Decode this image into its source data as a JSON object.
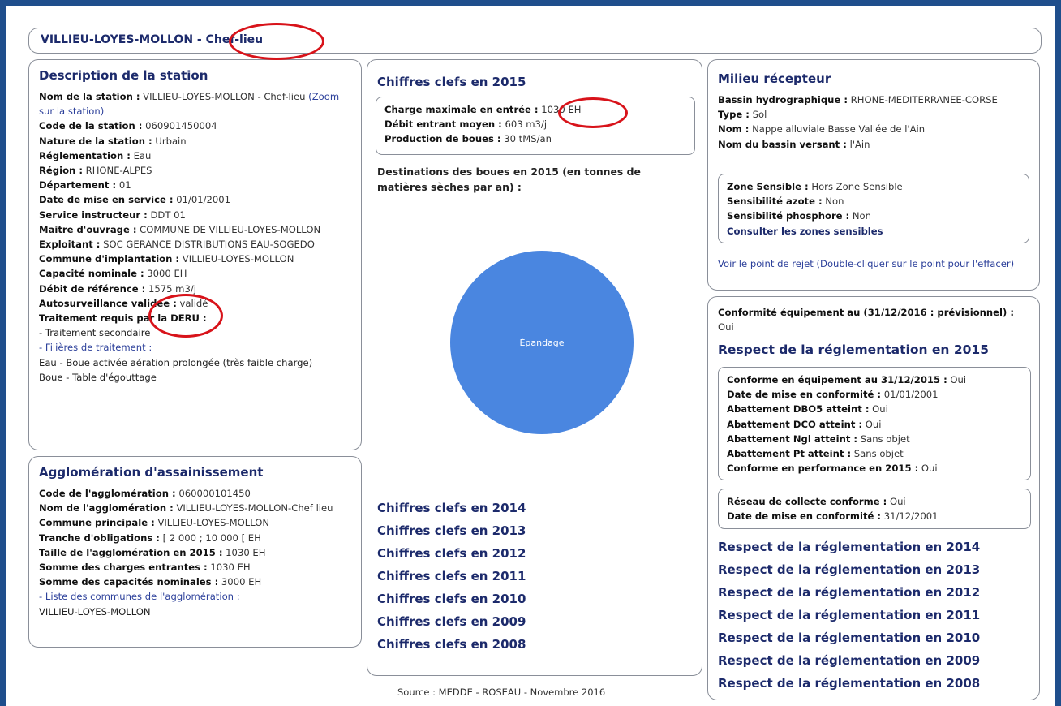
{
  "title": {
    "station": "VILLIEU-LOYES-MOLLON",
    "sep": " - ",
    "suffix": "Chef-lieu"
  },
  "description": {
    "heading": "Description de la station",
    "rows": [
      {
        "label": "Nom de la station :",
        "value": " VILLIEU-LOYES-MOLLON - Chef-lieu",
        "link": " (Zoom sur la station)"
      },
      {
        "label": "Code de la station :",
        "value": " 060901450004"
      },
      {
        "label": "Nature de la station :",
        "value": " Urbain"
      },
      {
        "label": "Réglementation :",
        "value": " Eau"
      },
      {
        "label": "Région :",
        "value": " RHONE-ALPES"
      },
      {
        "label": "Département :",
        "value": " 01"
      },
      {
        "label": "Date de mise en service :",
        "value": " 01/01/2001"
      },
      {
        "label": "Service instructeur :",
        "value": " DDT 01"
      },
      {
        "label": "Maitre d'ouvrage :",
        "value": " COMMUNE DE VILLIEU-LOYES-MOLLON"
      },
      {
        "label": "Exploitant :",
        "value": " SOC GERANCE DISTRIBUTIONS EAU-SOGEDO"
      },
      {
        "label": "Commune d'implantation :",
        "value": " VILLIEU-LOYES-MOLLON"
      },
      {
        "label": "Capacité nominale :",
        "value": " 3000 EH"
      },
      {
        "label": "Débit de référence :",
        "value": " 1575 m3/j"
      },
      {
        "label": "Autosurveillance validée :",
        "value": " validé"
      },
      {
        "label": "Traitement requis par la DERU :",
        "value": ""
      }
    ],
    "deru_value": "- Traitement secondaire",
    "filieres_link": "- Filières de traitement :",
    "filiere_eau": "Eau - Boue activée aération prolongée (très faible charge)",
    "filiere_boue": "Boue - Table d'égouttage"
  },
  "agglomeration": {
    "heading": "Agglomération d'assainissement",
    "rows": [
      {
        "label": "Code de l'agglomération :",
        "value": " 060000101450"
      },
      {
        "label": "Nom de l'agglomération :",
        "value": " VILLIEU-LOYES-MOLLON-Chef lieu"
      },
      {
        "label": "Commune principale :",
        "value": " VILLIEU-LOYES-MOLLON"
      },
      {
        "label": "Tranche d'obligations :",
        "value": " [ 2 000 ; 10 000 [ EH"
      },
      {
        "label": "Taille de l'agglomération en 2015 :",
        "value": " 1030 EH"
      },
      {
        "label": "Somme des charges entrantes :",
        "value": " 1030 EH"
      },
      {
        "label": "Somme des capacités nominales :",
        "value": " 3000 EH"
      }
    ],
    "communes_link": "- Liste des communes de l'agglomération :",
    "communes_value": "VILLIEU-LOYES-MOLLON"
  },
  "chiffres": {
    "heading": "Chiffres clefs en 2015",
    "rows": [
      {
        "label": "Charge maximale en entrée :",
        "value": " 1030 EH"
      },
      {
        "label": "Débit entrant moyen :",
        "value": " 603 m3/j"
      },
      {
        "label": "Production de boues :",
        "value": " 30 tMS/an"
      }
    ],
    "destinations_title": "Destinations des boues en 2015 (en tonnes de matières sèches par an) :",
    "years": [
      "Chiffres clefs en 2014",
      "Chiffres clefs en 2013",
      "Chiffres clefs en 2012",
      "Chiffres clefs en 2011",
      "Chiffres clefs en 2010",
      "Chiffres clefs en 2009",
      "Chiffres clefs en 2008"
    ]
  },
  "chart_data": {
    "type": "pie",
    "title": "Destinations des boues en 2015 (en tonnes de matières sèches par an) :",
    "categories": [
      "Épandage"
    ],
    "values": [
      100
    ],
    "colors": [
      "#4a86e0"
    ]
  },
  "milieu": {
    "heading": "Milieu récepteur",
    "rows": [
      {
        "label": "Bassin hydrographique :",
        "value": " RHONE-MEDITERRANEE-CORSE"
      },
      {
        "label": "Type :",
        "value": " Sol"
      },
      {
        "label": "Nom :",
        "value": " Nappe alluviale Basse Vallée de l'Ain"
      },
      {
        "label": "Nom du bassin versant :",
        "value": " l'Ain"
      }
    ],
    "zone": [
      {
        "label": "Zone Sensible :",
        "value": " Hors Zone Sensible"
      },
      {
        "label": "Sensibilité azote :",
        "value": " Non"
      },
      {
        "label": "Sensibilité phosphore :",
        "value": " Non"
      }
    ],
    "zones_link": "Consulter les zones sensibles",
    "rejet_link": "Voir le point de rejet (Double-cliquer sur le point pour l'effacer)"
  },
  "conformite": {
    "label": "Conformité équipement au (31/12/2016 : prévisionnel) :",
    "value": " Oui",
    "heading": "Respect de la réglementation en 2015",
    "rows": [
      {
        "label": "Conforme en équipement au 31/12/2015 :",
        "value": " Oui"
      },
      {
        "label": "Date de mise en conformité :",
        "value": " 01/01/2001"
      },
      {
        "label": "Abattement DBO5 atteint :",
        "value": " Oui"
      },
      {
        "label": "Abattement DCO atteint :",
        "value": " Oui"
      },
      {
        "label": "Abattement Ngl atteint :",
        "value": " Sans objet"
      },
      {
        "label": "Abattement Pt atteint :",
        "value": " Sans objet"
      },
      {
        "label": "Conforme en performance en 2015 :",
        "value": " Oui"
      }
    ],
    "reseau": [
      {
        "label": "Réseau de collecte conforme :",
        "value": " Oui"
      },
      {
        "label": "Date de mise en conformité :",
        "value": " 31/12/2001"
      }
    ],
    "years": [
      "Respect de la réglementation en 2014",
      "Respect de la réglementation en 2013",
      "Respect de la réglementation en 2012",
      "Respect de la réglementation en 2011",
      "Respect de la réglementation en 2010",
      "Respect de la réglementation en 2009",
      "Respect de la réglementation en 2008"
    ]
  },
  "source": "Source : MEDDE - ROSEAU - Novembre 2016",
  "colors": {
    "frame": "#1f4e8c",
    "heading": "#1c2a6b",
    "annotation": "#d8131a",
    "pie": "#4a86e0"
  }
}
